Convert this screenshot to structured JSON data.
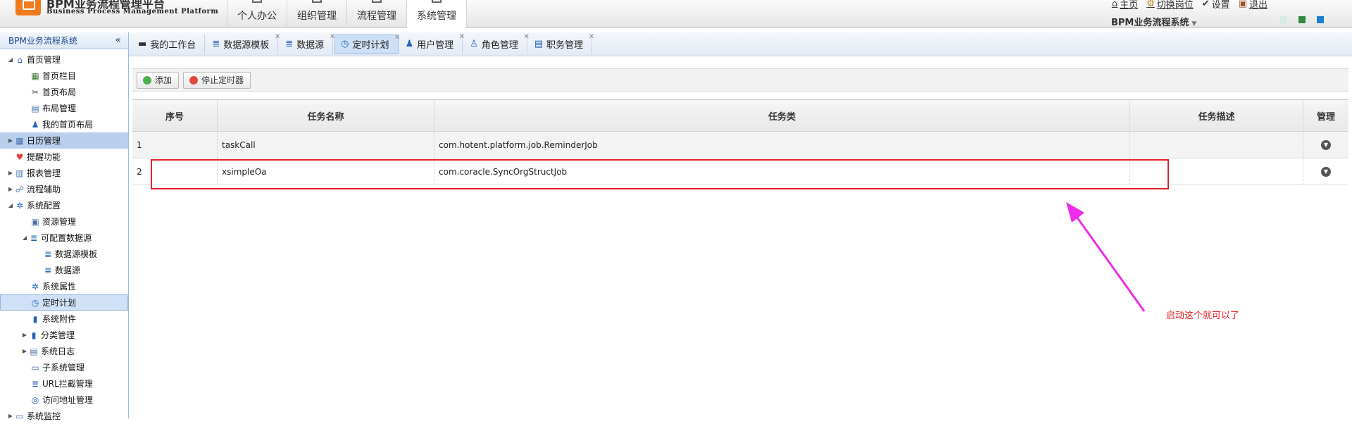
{
  "header": {
    "logo_sub": "Business Process Management Platform",
    "logo_top": "BPM业务流程管理平台",
    "nav": [
      {
        "label": "个人办公",
        "active": false
      },
      {
        "label": "组织管理",
        "active": false
      },
      {
        "label": "流程管理",
        "active": false
      },
      {
        "label": "系统管理",
        "active": true
      }
    ],
    "links": {
      "home": "主页",
      "switch": "切换岗位",
      "settings": "设置",
      "logout": "退出"
    },
    "system_name": "BPM业务流程系统",
    "skin_colors": [
      "#d5eae4",
      "#2f8a3c",
      "#1b7fd1"
    ]
  },
  "sidebar": {
    "title": "BPM业务流程系统",
    "items": [
      {
        "label": "首页管理",
        "icon": "home-icon",
        "arrow": "▲"
      },
      {
        "label": "首页栏目",
        "icon": "columns-icon"
      },
      {
        "label": "首页布局",
        "icon": "tools-icon"
      },
      {
        "label": "布局管理",
        "icon": "layout-icon"
      },
      {
        "label": "我的首页布局",
        "icon": "user-icon"
      },
      {
        "label": "日历管理",
        "icon": "calendar-icon",
        "arrow": "▶"
      },
      {
        "label": "提醒功能",
        "icon": "heart-icon"
      },
      {
        "label": "报表管理",
        "icon": "report-icon",
        "arrow": "▶"
      },
      {
        "label": "流程辅助",
        "icon": "flow-icon",
        "arrow": "▶"
      },
      {
        "label": "系统配置",
        "icon": "gear-icon",
        "arrow": "▲"
      },
      {
        "label": "资源管理",
        "icon": "resource-icon"
      },
      {
        "label": "可配置数据源",
        "icon": "database-icon",
        "arrow": "▲"
      },
      {
        "label": "数据源模板",
        "icon": "database-icon"
      },
      {
        "label": "数据源",
        "icon": "database-icon"
      },
      {
        "label": "系统属性",
        "icon": "gear-icon"
      },
      {
        "label": "定时计划",
        "icon": "clock-icon"
      },
      {
        "label": "系统附件",
        "icon": "attachment-icon"
      },
      {
        "label": "分类管理",
        "icon": "chart-icon",
        "arrow": "▶"
      },
      {
        "label": "系统日志",
        "icon": "log-icon",
        "arrow": "▶"
      },
      {
        "label": "子系统管理",
        "icon": "subsystem-icon"
      },
      {
        "label": "URL拦截管理",
        "icon": "filter-icon"
      },
      {
        "label": "访问地址管理",
        "icon": "link-icon"
      },
      {
        "label": "系统监控",
        "icon": "monitor-icon",
        "arrow": "▶"
      }
    ]
  },
  "tabs": [
    {
      "label": "我的工作台",
      "icon": "monitor-icon"
    },
    {
      "label": "数据源模板",
      "icon": "database-icon"
    },
    {
      "label": "数据源",
      "icon": "database-icon"
    },
    {
      "label": "定时计划",
      "icon": "clock-icon",
      "active": true
    },
    {
      "label": "用户管理",
      "icon": "user-icon"
    },
    {
      "label": "角色管理",
      "icon": "role-icon"
    },
    {
      "label": "职务管理",
      "icon": "position-icon"
    }
  ],
  "toolbar": {
    "add": "添加",
    "stop": "停止定时器"
  },
  "table": {
    "columns": [
      "序号",
      "任务名称",
      "任务类",
      "任务描述",
      "管理"
    ],
    "rows": [
      {
        "no": "1",
        "name": "taskCall",
        "class": "com.hotent.platform.job.ReminderJob",
        "desc": ""
      },
      {
        "no": "2",
        "name": "xsimpleOa",
        "class": "com.coracle.SyncOrgStructJob",
        "desc": ""
      }
    ]
  },
  "annotation": {
    "note": "启动这个就可以了",
    "color": "#e5202a",
    "arrow_color": "#ee2bea"
  }
}
